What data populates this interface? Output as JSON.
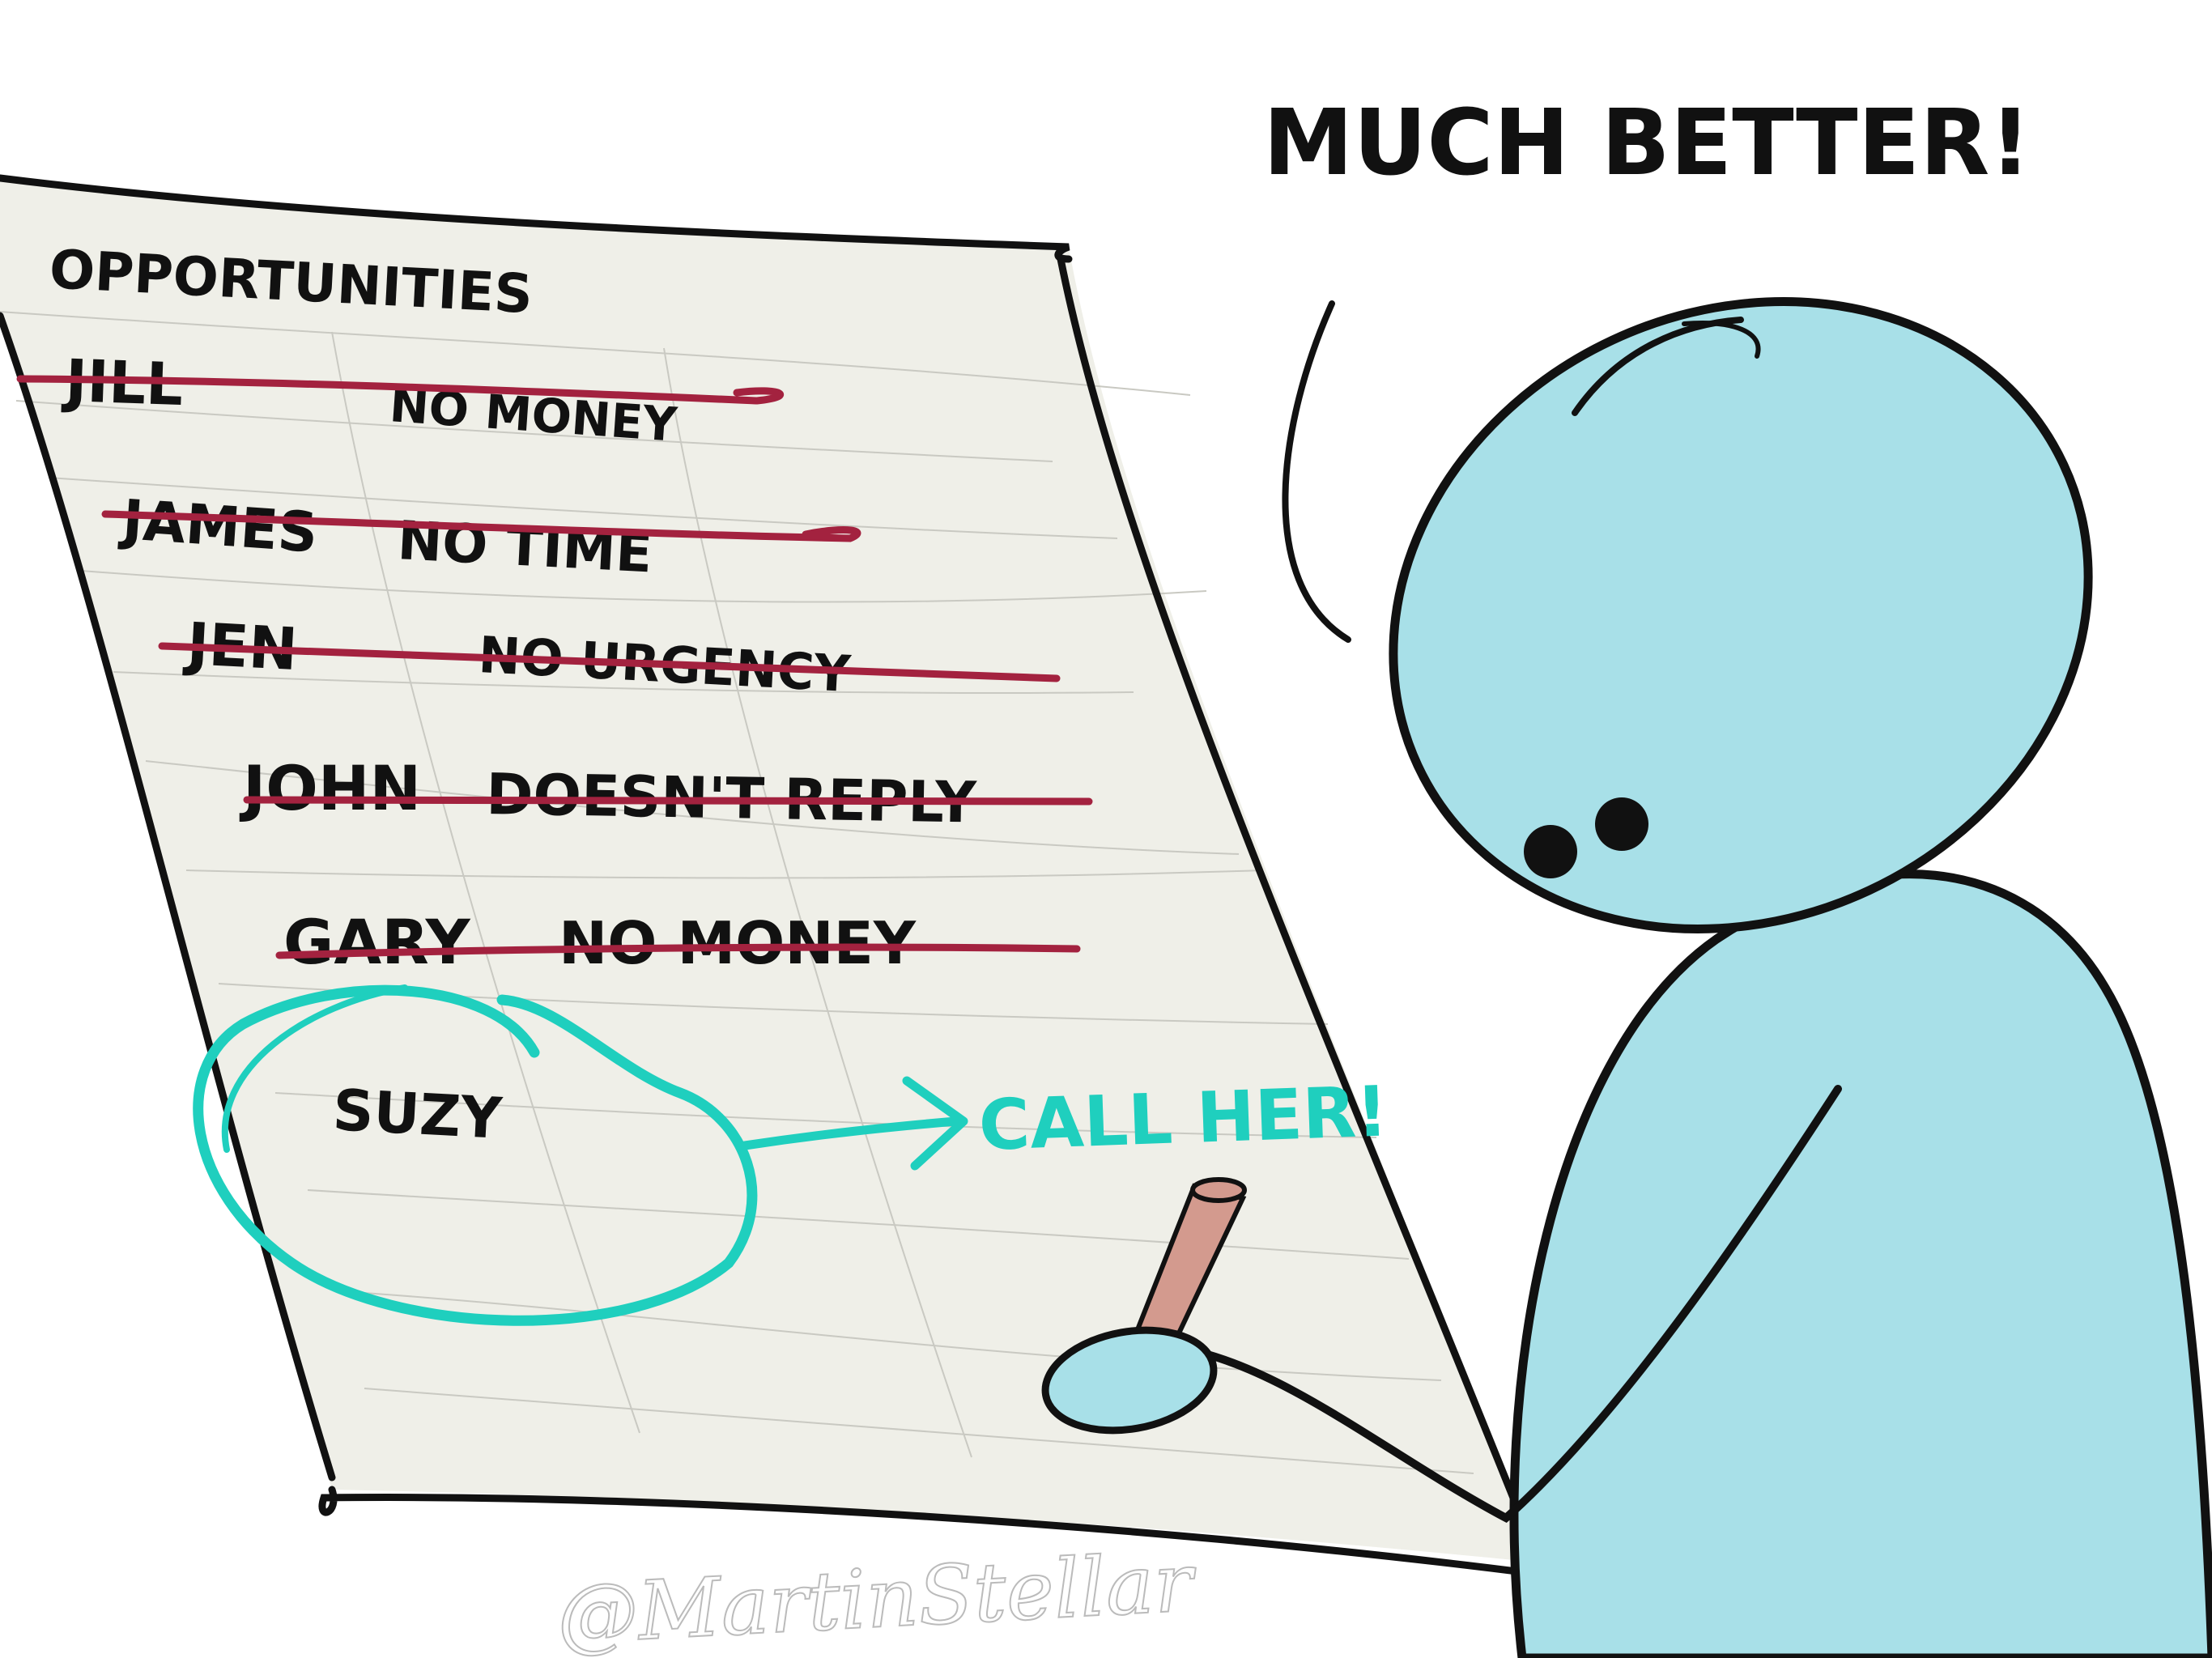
{
  "speech": {
    "text": "MUCH BETTER!"
  },
  "sheet": {
    "heading": "OPPORTUNITIES",
    "rows": [
      {
        "name": "JILL",
        "reason": "NO MONEY",
        "crossed_out": true
      },
      {
        "name": "JAMES",
        "reason": "NO TIME",
        "crossed_out": true
      },
      {
        "name": "JEN",
        "reason": "NO URGENCY",
        "crossed_out": true
      },
      {
        "name": "JOHN",
        "reason": "DOESN'T REPLY",
        "crossed_out": true
      },
      {
        "name": "GARY",
        "reason": "NO MONEY",
        "crossed_out": true
      }
    ],
    "highlight": {
      "name": "SUZY",
      "action": "CALL HER!"
    }
  },
  "signature": "@MartinStellar",
  "colors": {
    "paper": "#efefe8",
    "ink": "#111111",
    "strike": "#a3223f",
    "highlight": "#1fcfbe",
    "character": "#a8e0e8",
    "pencil": "#d39a8e"
  }
}
